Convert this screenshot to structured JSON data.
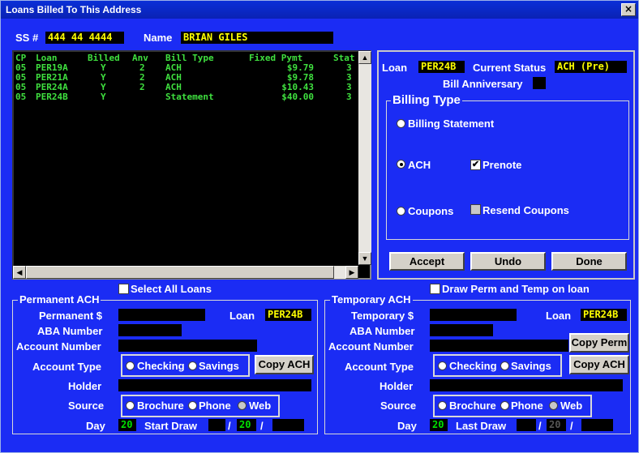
{
  "window": {
    "title": "Loans Billed To This Address",
    "close_glyph": "×"
  },
  "borrower": {
    "ss_label": "SS #",
    "ss_value": "444 44 4444",
    "name_label": "Name",
    "name_value": "BRIAN GILES"
  },
  "loan_list": {
    "columns": [
      "CP",
      "Loan",
      "Billed",
      "Anv",
      "Bill Type",
      "Fixed Pymt",
      "Stat"
    ],
    "rows": [
      [
        "05",
        "PER19A",
        "Y",
        "2",
        "ACH",
        "$9.79",
        "3"
      ],
      [
        "05",
        "PER21A",
        "Y",
        "2",
        "ACH",
        "$9.78",
        "3"
      ],
      [
        "05",
        "PER24A",
        "Y",
        "2",
        "ACH",
        "$10.43",
        "3"
      ],
      [
        "05",
        "PER24B",
        "Y",
        "",
        "Statement",
        "$40.00",
        "3"
      ]
    ]
  },
  "loan_panel": {
    "loan_label": "Loan",
    "loan_value": "PER24B",
    "status_label": "Current Status",
    "status_value": "ACH (Pre)",
    "anniv_label": "Bill Anniversary",
    "anniv_value": "",
    "billing_type": {
      "title": "Billing Type",
      "statement_label": "Billing Statement",
      "ach_label": "ACH",
      "prenote_label": "Prenote",
      "coupons_label": "Coupons",
      "resend_label": "Resend Coupons",
      "selected": "ACH",
      "prenote_checked": true
    },
    "buttons": {
      "accept": "Accept",
      "undo": "Undo",
      "done": "Done"
    }
  },
  "select_all_label": "Select All Loans",
  "draw_perm_temp_label": "Draw Perm and Temp on loan",
  "permanent": {
    "title": "Permanent ACH",
    "amount_label": "Permanent $",
    "amount_value": "",
    "loan_label": "Loan",
    "loan_value": "PER24B",
    "aba_label": "ABA Number",
    "aba_value": "",
    "account_label": "Account Number",
    "account_value": "",
    "type_label": "Account Type",
    "checking": "Checking",
    "savings": "Savings",
    "copy_ach": "Copy ACH",
    "holder_label": "Holder",
    "holder_value": "",
    "source_label": "Source",
    "brochure": "Brochure",
    "phone": "Phone",
    "web": "Web",
    "day_label": "Day",
    "day_value": "20",
    "draw_label": "Start Draw",
    "draw_month": "",
    "draw_day": "20",
    "draw_year": "",
    "slash": "/"
  },
  "temporary": {
    "title": "Temporary ACH",
    "amount_label": "Temporary $",
    "amount_value": "",
    "loan_label": "Loan",
    "loan_value": "PER24B",
    "aba_label": "ABA Number",
    "aba_value": "",
    "account_label": "Account Number",
    "account_value": "",
    "copy_perm": "Copy Perm",
    "type_label": "Account Type",
    "checking": "Checking",
    "savings": "Savings",
    "copy_ach": "Copy ACH",
    "holder_label": "Holder",
    "holder_value": "",
    "source_label": "Source",
    "brochure": "Brochure",
    "phone": "Phone",
    "web": "Web",
    "day_label": "Day",
    "day_value": "20",
    "draw_label": "Last Draw",
    "draw_month": "",
    "draw_day": "20",
    "draw_year": "",
    "slash": "/"
  },
  "colors": {
    "background": "#1b2cf4",
    "field_bg": "#000000",
    "field_text": "#ffff00",
    "list_text": "#3fe03f"
  }
}
